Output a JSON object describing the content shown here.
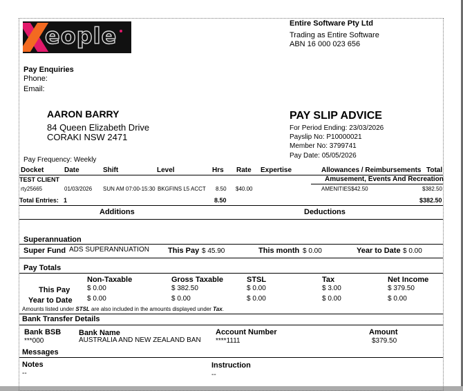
{
  "company": {
    "name": "Entire Software Pty Ltd",
    "trading": "Trading as Entire Software",
    "abn": "ABN 16 000 023 656"
  },
  "brand": {
    "pink": "#e2196b",
    "orange": "#f36a21"
  },
  "enquiries": {
    "title": "Pay Enquiries",
    "phone": "Phone:",
    "email": "Email:"
  },
  "employee": {
    "name": "AARON BARRY",
    "address1": "84 Queen Elizabeth Drive",
    "address2": "CORAKI  NSW 2471"
  },
  "advice": {
    "title": "PAY SLIP ADVICE",
    "period": "For Period Ending: 23/03/2026",
    "payslip": "Payslip No: P10000021",
    "member": "Member No: 3799741",
    "paydate": "Pay Date: 05/05/2026"
  },
  "frequency": "Pay Frequency: Weekly",
  "table": {
    "headers": {
      "docket": "Docket",
      "date": "Date",
      "shift": "Shift",
      "level": "Level",
      "hrs": "Hrs",
      "rate": "Rate",
      "expertise": "Expertise",
      "allowances": "Allowances / Reimbursements",
      "total": "Total"
    },
    "client": "TEST CLIENT",
    "category": "Amusement, Events And Recreation",
    "row": {
      "docket": "rty25665",
      "date": "01/03/2026",
      "shift": "SUN  AM 07:00-15:30",
      "level": "BKGFINS L5 ACCT",
      "hrs": "8.50",
      "rate": "$40.00",
      "allowance": "AMENITIES$42.50",
      "total": "$382.50"
    },
    "totals": {
      "label": "Total Entries:",
      "count": "1",
      "hrs": "8.50",
      "total": "$382.50"
    }
  },
  "additions": "Additions",
  "deductions": "Deductions",
  "super": {
    "title": "Superannuation",
    "fund_label": "Super Fund",
    "fund_name": "ADS SUPERANNUATION",
    "this_pay_label": "This Pay",
    "this_pay": "$ 45.90",
    "this_month_label": "This month",
    "this_month": "$ 0.00",
    "ytd_label": "Year to Date",
    "ytd": "$ 0.00"
  },
  "paytotals": {
    "title": "Pay Totals",
    "cols": [
      "Non-Taxable",
      "Gross Taxable",
      "STSL",
      "Tax",
      "Net Income"
    ],
    "this_pay_label": "This Pay",
    "this_pay": [
      "$ 0.00",
      "$ 382.50",
      "$ 0.00",
      "$ 3.00",
      "$ 379.50"
    ],
    "ytd_label": "Year to Date",
    "ytd": [
      "$ 0.00",
      "$ 0.00",
      "$ 0.00",
      "$ 0.00",
      "$ 0.00"
    ],
    "note_a": "Amounts listed under ",
    "note_b": "STSL",
    "note_c": "  are also included in the amounts displayed under ",
    "note_d": "Tax",
    "note_e": "."
  },
  "bank": {
    "title": "Bank Transfer Details",
    "bsb_label": "Bank BSB",
    "bsb": "***000",
    "name_label": "Bank Name",
    "name": "AUSTRALIA AND NEW ZEALAND BAN",
    "acct_label": "Account Number",
    "acct": "****1111",
    "amount_label": "Amount",
    "amount": "$379.50"
  },
  "messages": {
    "title": "Messages",
    "notes_label": "Notes",
    "notes": "--",
    "instr_label": "Instruction",
    "instr": "--"
  }
}
